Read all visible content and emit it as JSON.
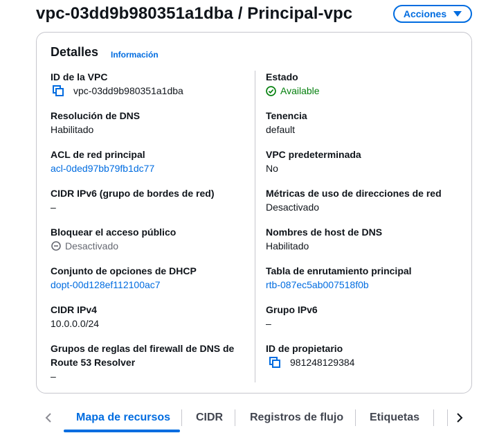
{
  "header": {
    "title": "vpc-03dd9b980351a1dba / Principal-vpc",
    "actions_label": "Acciones"
  },
  "details": {
    "title": "Detalles",
    "info_link": "Información",
    "left": [
      {
        "label": "ID de la VPC",
        "value": "vpc-03dd9b980351a1dba"
      },
      {
        "label": "Resolución de DNS",
        "value": "Habilitado"
      },
      {
        "label": "ACL de red principal",
        "value": "acl-0ded97bb79fb1dc77"
      },
      {
        "label": "CIDR IPv6 (grupo de bordes de red)",
        "value": "–"
      },
      {
        "label": "Bloquear el acceso público",
        "value": "Desactivado"
      },
      {
        "label": "Conjunto de opciones de DHCP",
        "value": "dopt-00d128ef112100ac7"
      },
      {
        "label": "CIDR IPv4",
        "value": "10.0.0.0/24"
      },
      {
        "label_line1": "Grupos de reglas del firewall de DNS de",
        "label_line2": "Route 53 Resolver",
        "value": "–"
      }
    ],
    "right": [
      {
        "label": "Estado",
        "value": "Available"
      },
      {
        "label": "Tenencia",
        "value": "default"
      },
      {
        "label": "VPC predeterminada",
        "value": "No"
      },
      {
        "label": "Métricas de uso de direcciones de red",
        "value": "Desactivado"
      },
      {
        "label": "Nombres de host de DNS",
        "value": "Habilitado"
      },
      {
        "label": "Tabla de enrutamiento principal",
        "value": "rtb-087ec5ab007518f0b"
      },
      {
        "label": "Grupo IPv6",
        "value": "–"
      },
      {
        "label": "ID de propietario",
        "value": "981248129384"
      }
    ]
  },
  "tabs": [
    {
      "label": "Mapa de recursos",
      "active": true
    },
    {
      "label": "CIDR",
      "active": false
    },
    {
      "label": "Registros de flujo",
      "active": false
    },
    {
      "label": "Etiquetas",
      "active": false
    }
  ],
  "colors": {
    "link": "#006ce0",
    "success": "#037f0c",
    "text": "#0f141a"
  },
  "icons": {
    "copy": "copy-icon",
    "status_ok": "check-circle-icon",
    "status_off": "minus-circle-icon",
    "tabs_prev": "chevron-left-icon",
    "tabs_next": "chevron-right-icon",
    "dropdown": "caret-down-icon"
  }
}
